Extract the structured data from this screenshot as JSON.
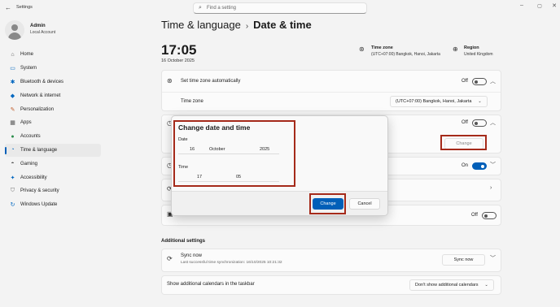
{
  "app": {
    "title": "Settings",
    "back_icon": "back-arrow-icon",
    "window_controls": [
      "minimize-icon",
      "maximize-icon",
      "close-icon"
    ]
  },
  "search": {
    "placeholder": "Find a setting"
  },
  "profile": {
    "name": "Admin",
    "account_type": "Local Account"
  },
  "sidebar": {
    "items": [
      {
        "label": "Home",
        "icon": "home-icon"
      },
      {
        "label": "System",
        "icon": "system-icon"
      },
      {
        "label": "Bluetooth & devices",
        "icon": "bluetooth-icon"
      },
      {
        "label": "Network & internet",
        "icon": "wifi-icon"
      },
      {
        "label": "Personalization",
        "icon": "brush-icon"
      },
      {
        "label": "Apps",
        "icon": "apps-icon"
      },
      {
        "label": "Accounts",
        "icon": "accounts-icon"
      },
      {
        "label": "Time & language",
        "icon": "globe-clock-icon",
        "active": true
      },
      {
        "label": "Gaming",
        "icon": "gamepad-icon"
      },
      {
        "label": "Accessibility",
        "icon": "accessibility-icon"
      },
      {
        "label": "Privacy & security",
        "icon": "shield-icon"
      },
      {
        "label": "Windows Update",
        "icon": "update-icon"
      }
    ]
  },
  "breadcrumb": {
    "parent": "Time & language",
    "separator": "›",
    "current": "Date & time"
  },
  "clock": {
    "time": "17:05",
    "date": "16 October 2025"
  },
  "timezone_info": {
    "title": "Time zone",
    "value": "(UTC+07:00) Bangkok, Hanoi, Jakarta"
  },
  "region_info": {
    "title": "Region",
    "value": "United Kingdom"
  },
  "settings": {
    "set_tz_auto": {
      "label": "Set time zone automatically",
      "state": "Off"
    },
    "time_zone": {
      "label": "Time zone",
      "value": "(UTC+07:00) Bangkok, Hanoi, Jakarta"
    },
    "set_time_auto": {
      "state": "Off"
    },
    "manual_change_button": "Change",
    "toggle_on": {
      "state": "On"
    },
    "toggle_off_lower": {
      "state": "Off"
    }
  },
  "additional": {
    "section_title": "Additional settings",
    "sync": {
      "label": "Sync now",
      "sub": "Last successful time synchronization: 16/10/2025 10:21:32",
      "button": "Sync now"
    },
    "calendars": {
      "label": "Show additional calendars in the taskbar",
      "value": "Don't show additional calendars"
    }
  },
  "dialog": {
    "title": "Change date and time",
    "date_label": "Date",
    "day": "16",
    "month": "October",
    "year": "2025",
    "time_label": "Time",
    "hour": "17",
    "minute": "05",
    "primary_button": "Change",
    "secondary_button": "Cancel"
  },
  "colors": {
    "accent": "#005fb8",
    "highlight_box": "#a52a1a",
    "background": "#f3f3f3",
    "card": "#fbfbfb"
  }
}
